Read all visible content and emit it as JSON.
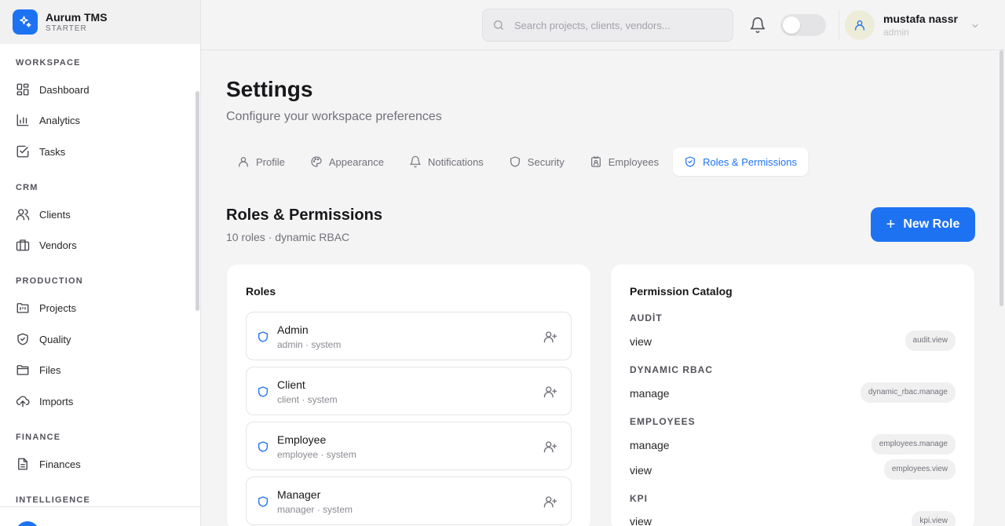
{
  "app": {
    "name": "Aurum TMS",
    "plan": "STARTER"
  },
  "sidebar": {
    "sections": [
      {
        "label": "WORKSPACE",
        "items": [
          {
            "label": "Dashboard",
            "icon": "dashboard-icon"
          },
          {
            "label": "Analytics",
            "icon": "bar-chart-icon"
          },
          {
            "label": "Tasks",
            "icon": "check-square-icon"
          }
        ]
      },
      {
        "label": "CRM",
        "items": [
          {
            "label": "Clients",
            "icon": "users-icon"
          },
          {
            "label": "Vendors",
            "icon": "briefcase-icon"
          }
        ]
      },
      {
        "label": "PRODUCTION",
        "items": [
          {
            "label": "Projects",
            "icon": "folder-kanban-icon"
          },
          {
            "label": "Quality",
            "icon": "shield-check-icon"
          },
          {
            "label": "Files",
            "icon": "folder-icon"
          },
          {
            "label": "Imports",
            "icon": "upload-cloud-icon"
          }
        ]
      },
      {
        "label": "FINANCE",
        "items": [
          {
            "label": "Finances",
            "icon": "file-text-icon"
          }
        ]
      },
      {
        "label": "INTELLIGENCE",
        "items": []
      }
    ]
  },
  "topbar": {
    "search_placeholder": "Search projects, clients, vendors...",
    "user": {
      "name": "mustafa nassr",
      "role": "admin"
    }
  },
  "page": {
    "title": "Settings",
    "subtitle": "Configure your workspace preferences",
    "tabs": [
      {
        "label": "Profile",
        "icon": "user-icon",
        "active": false
      },
      {
        "label": "Appearance",
        "icon": "palette-icon",
        "active": false
      },
      {
        "label": "Notifications",
        "icon": "bell-icon",
        "active": false
      },
      {
        "label": "Security",
        "icon": "shield-icon",
        "active": false
      },
      {
        "label": "Employees",
        "icon": "id-badge-icon",
        "active": false
      },
      {
        "label": "Roles & Permissions",
        "icon": "shield-check-icon",
        "active": true
      }
    ]
  },
  "roles_section": {
    "title": "Roles & Permissions",
    "subtitle": "10 roles · dynamic RBAC",
    "new_role_label": "New Role"
  },
  "roles_card": {
    "title": "Roles",
    "roles": [
      {
        "name": "Admin",
        "meta": "admin · system"
      },
      {
        "name": "Client",
        "meta": "client · system"
      },
      {
        "name": "Employee",
        "meta": "employee · system"
      },
      {
        "name": "Manager",
        "meta": "manager · system"
      }
    ]
  },
  "permission_catalog": {
    "title": "Permission Catalog",
    "groups": [
      {
        "label": "AUDİT",
        "perms": [
          {
            "action": "view",
            "code": "audit.view"
          }
        ]
      },
      {
        "label": "DYNAMIC RBAC",
        "perms": [
          {
            "action": "manage",
            "code": "dynamic_rbac.manage"
          }
        ]
      },
      {
        "label": "EMPLOYEES",
        "perms": [
          {
            "action": "manage",
            "code": "employees.manage"
          },
          {
            "action": "view",
            "code": "employees.view"
          }
        ]
      },
      {
        "label": "KPI",
        "perms": [
          {
            "action": "view",
            "code": "kpi.view"
          }
        ]
      }
    ]
  },
  "colors": {
    "accent": "#1d72f2",
    "background": "#f4f4f5",
    "card": "#ffffff"
  }
}
